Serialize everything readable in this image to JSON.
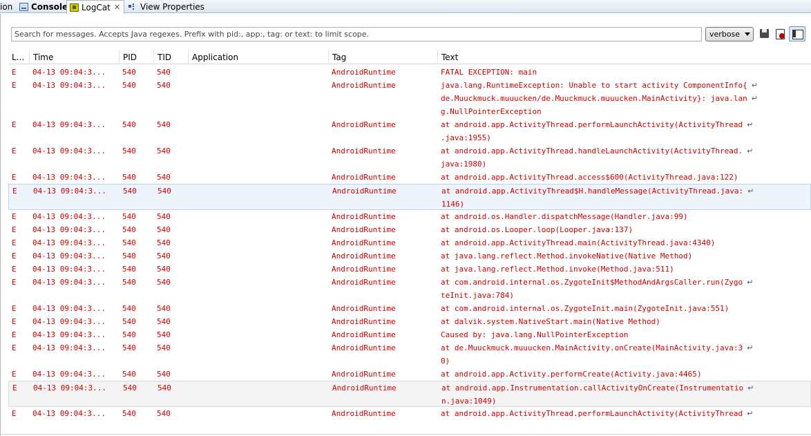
{
  "tabs": [
    {
      "label": "ion",
      "icon": "none"
    },
    {
      "label": "Console",
      "icon": "console-icon"
    },
    {
      "label": "LogCat",
      "icon": "logcat-icon",
      "active": true,
      "closable": true
    },
    {
      "label": "View Properties",
      "icon": "view-properties-icon"
    }
  ],
  "toolbar": {
    "search_placeholder": "Search for messages. Accepts Java regexes. Prefix with pid:, app:, tag: or text: to limit scope.",
    "search_value": "",
    "log_level": "verbose"
  },
  "columns": [
    "L...",
    "Time",
    "PID",
    "TID",
    "Application",
    "Tag",
    "Text"
  ],
  "colors": {
    "error_text": "#d40000"
  },
  "rows": [
    {
      "level": "E",
      "time": "04-13 09:04:3...",
      "pid": "540",
      "tid": "540",
      "app": "",
      "tag": "AndroidRuntime",
      "lines": [
        "FATAL EXCEPTION: main"
      ]
    },
    {
      "level": "E",
      "time": "04-13 09:04:3...",
      "pid": "540",
      "tid": "540",
      "app": "",
      "tag": "AndroidRuntime",
      "lines": [
        "java.lang.RuntimeException: Unable to start activity ComponentInfo{",
        "de.Muuckmuck.muuucken/de.Muuckmuck.muuucken.MainActivity}: java.lan",
        "g.NullPointerException"
      ]
    },
    {
      "level": "E",
      "time": "04-13 09:04:3...",
      "pid": "540",
      "tid": "540",
      "app": "",
      "tag": "AndroidRuntime",
      "lines": [
        "at android.app.ActivityThread.performLaunchActivity(ActivityThread",
        ".java:1955)"
      ]
    },
    {
      "level": "E",
      "time": "04-13 09:04:3...",
      "pid": "540",
      "tid": "540",
      "app": "",
      "tag": "AndroidRuntime",
      "lines": [
        "at android.app.ActivityThread.handleLaunchActivity(ActivityThread.",
        "java:1980)"
      ]
    },
    {
      "level": "E",
      "time": "04-13 09:04:3...",
      "pid": "540",
      "tid": "540",
      "app": "",
      "tag": "AndroidRuntime",
      "lines": [
        "at android.app.ActivityThread.access$600(ActivityThread.java:122)"
      ]
    },
    {
      "level": "E",
      "time": "04-13 09:04:3...",
      "pid": "540",
      "tid": "540",
      "app": "",
      "tag": "AndroidRuntime",
      "lines": [
        "at android.app.ActivityThread$H.handleMessage(ActivityThread.java:",
        "1146)"
      ]
    },
    {
      "level": "E",
      "time": "04-13 09:04:3...",
      "pid": "540",
      "tid": "540",
      "app": "",
      "tag": "AndroidRuntime",
      "lines": [
        "at android.os.Handler.dispatchMessage(Handler.java:99)"
      ]
    },
    {
      "level": "E",
      "time": "04-13 09:04:3...",
      "pid": "540",
      "tid": "540",
      "app": "",
      "tag": "AndroidRuntime",
      "lines": [
        "at android.os.Looper.loop(Looper.java:137)"
      ]
    },
    {
      "level": "E",
      "time": "04-13 09:04:3...",
      "pid": "540",
      "tid": "540",
      "app": "",
      "tag": "AndroidRuntime",
      "lines": [
        "at android.app.ActivityThread.main(ActivityThread.java:4340)"
      ]
    },
    {
      "level": "E",
      "time": "04-13 09:04:3...",
      "pid": "540",
      "tid": "540",
      "app": "",
      "tag": "AndroidRuntime",
      "lines": [
        "at java.lang.reflect.Method.invokeNative(Native Method)"
      ]
    },
    {
      "level": "E",
      "time": "04-13 09:04:3...",
      "pid": "540",
      "tid": "540",
      "app": "",
      "tag": "AndroidRuntime",
      "lines": [
        "at java.lang.reflect.Method.invoke(Method.java:511)"
      ]
    },
    {
      "level": "E",
      "time": "04-13 09:04:3...",
      "pid": "540",
      "tid": "540",
      "app": "",
      "tag": "AndroidRuntime",
      "lines": [
        "at com.android.internal.os.ZygoteInit$MethodAndArgsCaller.run(Zygo",
        "teInit.java:784)"
      ]
    },
    {
      "level": "E",
      "time": "04-13 09:04:3...",
      "pid": "540",
      "tid": "540",
      "app": "",
      "tag": "AndroidRuntime",
      "lines": [
        "at com.android.internal.os.ZygoteInit.main(ZygoteInit.java:551)"
      ]
    },
    {
      "level": "E",
      "time": "04-13 09:04:3...",
      "pid": "540",
      "tid": "540",
      "app": "",
      "tag": "AndroidRuntime",
      "lines": [
        "at dalvik.system.NativeStart.main(Native Method)"
      ]
    },
    {
      "level": "E",
      "time": "04-13 09:04:3...",
      "pid": "540",
      "tid": "540",
      "app": "",
      "tag": "AndroidRuntime",
      "lines": [
        "Caused by: java.lang.NullPointerException"
      ]
    },
    {
      "level": "E",
      "time": "04-13 09:04:3...",
      "pid": "540",
      "tid": "540",
      "app": "",
      "tag": "AndroidRuntime",
      "lines": [
        "at de.Muuckmuck.muuucken.MainActivity.onCreate(MainActivity.java:3",
        "0)"
      ]
    },
    {
      "level": "E",
      "time": "04-13 09:04:3...",
      "pid": "540",
      "tid": "540",
      "app": "",
      "tag": "AndroidRuntime",
      "lines": [
        "at android.app.Activity.performCreate(Activity.java:4465)"
      ]
    },
    {
      "level": "E",
      "time": "04-13 09:04:3...",
      "pid": "540",
      "tid": "540",
      "app": "",
      "tag": "AndroidRuntime",
      "lines": [
        "at android.app.Instrumentation.callActivityOnCreate(Instrumentatio",
        "n.java:1049)"
      ]
    },
    {
      "level": "E",
      "time": "04-13 09:04:3...",
      "pid": "540",
      "tid": "540",
      "app": "",
      "tag": "AndroidRuntime",
      "lines": [
        "at android.app.ActivityThread.performLaunchActivity(ActivityThread"
      ]
    }
  ]
}
